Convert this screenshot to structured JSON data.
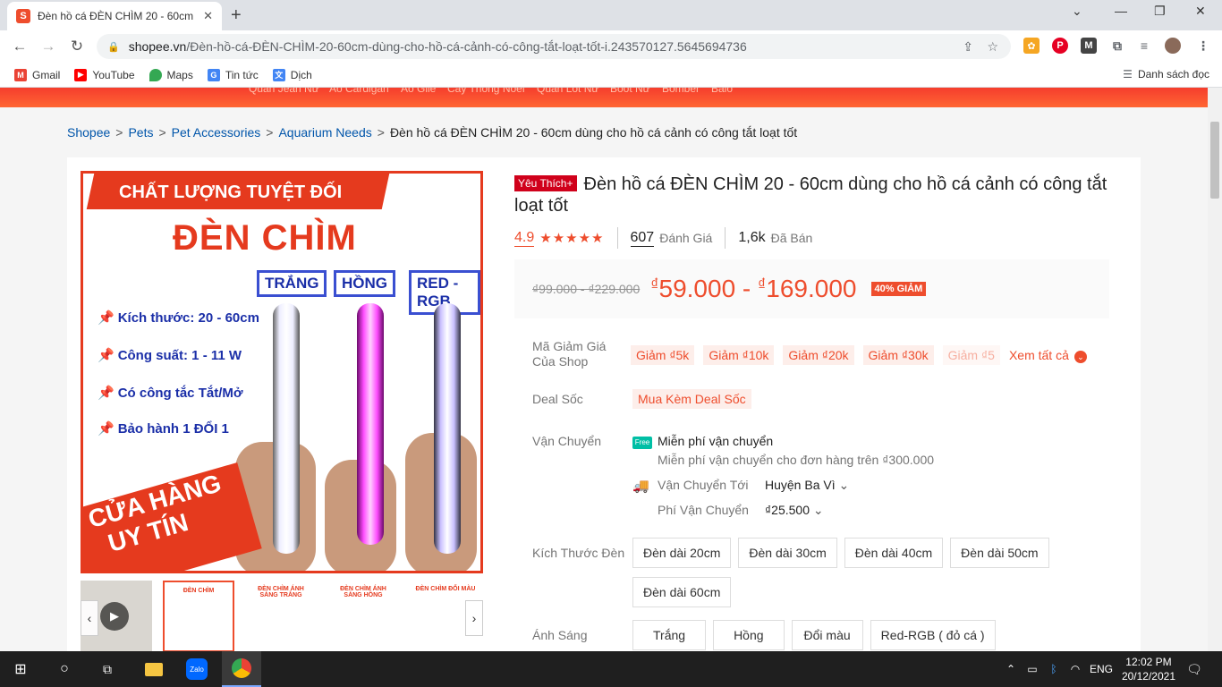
{
  "browser": {
    "tab_title": "Đèn hồ cá ĐÈN CHÌM 20 - 60cm",
    "url_host": "shopee.vn",
    "url_path": "/Đèn-hồ-cá-ĐÈN-CHÌM-20-60cm-dùng-cho-hồ-cá-cảnh-có-công-tắt-loạt-tốt-i.243570127.5645694736",
    "bookmarks": [
      "Gmail",
      "YouTube",
      "Maps",
      "Tin tức",
      "Dịch"
    ],
    "reading_list": "Danh sách đọc"
  },
  "top_band": [
    "Quần Jean Nữ",
    "Áo Cardigan",
    "Áo Gile",
    "Cây Thông Noel",
    "Quần Lót Nữ",
    "Boot Nữ",
    "Bomber",
    "Balo"
  ],
  "breadcrumb": [
    "Shopee",
    "Pets",
    "Pet Accessories",
    "Aquarium Needs",
    "Đèn hồ cá ĐÈN CHÌM 20 - 60cm dùng cho hồ cá cảnh có công tắt loạt tốt"
  ],
  "image": {
    "banner": "CHẤT LƯỢNG TUYỆT ĐỐI",
    "headline": "ĐÈN CHÌM",
    "tags": [
      "TRẮNG",
      "HỒNG",
      "RED -RGB"
    ],
    "features": [
      "Kích thước: 20 - 60cm",
      "Công suất: 1 - 11 W",
      "Có công tắc Tắt/Mở",
      "Bảo hành 1 ĐỔI 1"
    ],
    "store_line1": "CỬA HÀNG",
    "store_line2": "UY TÍN",
    "thumbs": [
      "",
      "ĐÈN CHÌM",
      "ĐÈN CHÌM ÁNH SÁNG TRẮNG",
      "ĐÈN CHÌM ÁNH SÁNG HỒNG",
      "ĐÈN CHÌM ĐỔI MÀU"
    ]
  },
  "product": {
    "badge": "Yêu Thích+",
    "title": "Đèn hồ cá ĐÈN CHÌM 20 - 60cm dùng cho hồ cá cảnh có công tắt loạt tốt",
    "rating": "4.9",
    "reviews": "607",
    "reviews_label": "Đánh Giá",
    "sold": "1,6k",
    "sold_label": "Đã Bán",
    "old_price": "₫99.000 - ₫229.000",
    "price_low": "59.000",
    "price_high": "169.000",
    "currency": "₫",
    "price_sep": " - ",
    "discount": "40% GIẢM"
  },
  "vouchers": {
    "label": "Mã Giảm Giá Của Shop",
    "items": [
      "Giảm ₫5k",
      "Giảm ₫10k",
      "Giảm ₫20k",
      "Giảm ₫30k",
      "Giảm ₫5"
    ],
    "see_all": "Xem tất cả"
  },
  "deal": {
    "label": "Deal Sốc",
    "value": "Mua Kèm Deal Sốc"
  },
  "shipping": {
    "label": "Vận Chuyển",
    "free_icon": "Free",
    "free": "Miễn phí vận chuyển",
    "free_note": "Miễn phí vận chuyển cho đơn hàng trên ₫300.000",
    "to_label": "Vận Chuyển Tới",
    "to_value": "Huyện Ba Vì",
    "fee_label": "Phí Vận Chuyển",
    "fee_value": "₫25.500"
  },
  "size": {
    "label": "Kích Thước Đèn",
    "options": [
      "Đèn dài 20cm",
      "Đèn dài 30cm",
      "Đèn dài 40cm",
      "Đèn dài 50cm",
      "Đèn dài 60cm"
    ]
  },
  "light": {
    "label": "Ánh Sáng",
    "options": [
      "Trắng",
      "Hồng",
      "Đổi màu",
      "Red-RGB ( đỏ cá )"
    ]
  },
  "taskbar": {
    "lang": "ENG",
    "time": "12:02 PM",
    "date": "20/12/2021"
  },
  "colors": {
    "shopee_orange": "#ee4d2d",
    "link_blue": "#0055aa"
  }
}
